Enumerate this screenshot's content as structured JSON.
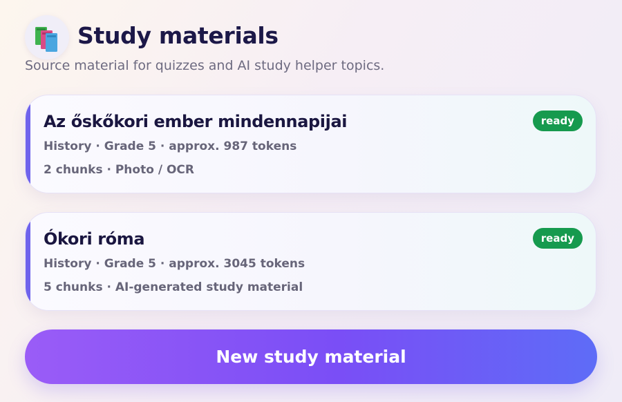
{
  "header": {
    "logo_icon": "books-icon",
    "title": "Study materials",
    "subtitle": "Source material for quizzes and AI study helper topics."
  },
  "materials": [
    {
      "title": "Az őskőkori ember mindennapijai",
      "meta_line1": "History · Grade 5 · approx. 987 tokens",
      "meta_line2": "2 chunks · Photo / OCR",
      "status": "ready"
    },
    {
      "title": "Ókori róma",
      "meta_line1": "History · Grade 5 · approx. 3045 tokens",
      "meta_line2": "5 chunks · AI-generated study material",
      "status": "ready"
    }
  ],
  "new_button_label": "New study material",
  "colors": {
    "accent": "#6f63ec",
    "ready_badge": "#169a4e",
    "button_gradient_start": "#9a5cf7",
    "button_gradient_end": "#5e6cf7"
  }
}
